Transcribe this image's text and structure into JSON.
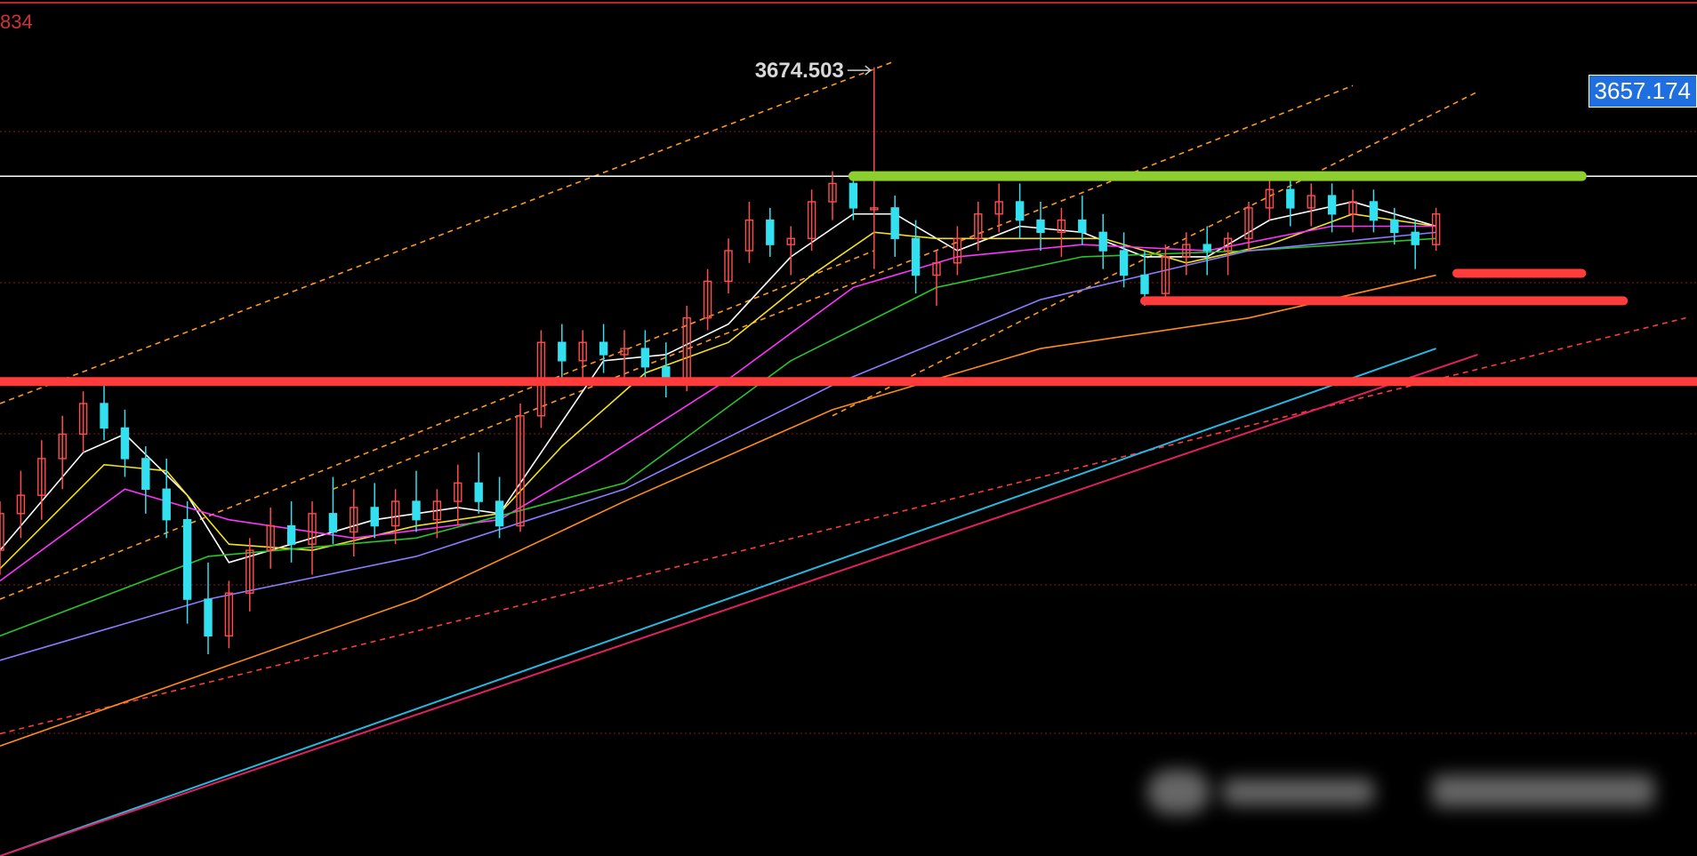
{
  "chart_data": {
    "type": "candlestick",
    "title": "",
    "xlabel": "",
    "ylabel": "",
    "ylim": [
      3546.0,
      3686.0
    ],
    "top_left_label": "834",
    "current_price": "3657.174",
    "high_annotation": "3674.503",
    "grid": "dotted red horizontal lines",
    "colors": {
      "background": "#000000",
      "bull_candle": "#ff4d4d",
      "bear_candle": "#33e0f0",
      "resistance": "#8ccf2e",
      "support": "#ff3b3b",
      "channel": "#ff9a1a",
      "ma5": "#ffffff",
      "ma10": "#f2e020",
      "ma20": "#ff33ff",
      "ma30": "#29c429",
      "ma60": "#8a7cff",
      "ma120": "#ff8c1a",
      "long_trend_1": "#29b7e0",
      "long_trend_2": "#e02060"
    },
    "horizontal_levels": [
      {
        "name": "resistance",
        "value": 3657.2
      },
      {
        "name": "support-minor",
        "value": 3641.3
      },
      {
        "name": "support-mid",
        "value": 3636.8
      },
      {
        "name": "support-major",
        "value": 3623.6
      }
    ],
    "candles": [
      [
        0,
        3596,
        3604,
        3592,
        3602
      ],
      [
        1,
        3602,
        3609,
        3598,
        3605
      ],
      [
        2,
        3605,
        3614,
        3601,
        3611
      ],
      [
        3,
        3611,
        3618,
        3606,
        3615
      ],
      [
        4,
        3615,
        3622,
        3612,
        3620
      ],
      [
        5,
        3620,
        3624,
        3614,
        3616
      ],
      [
        6,
        3616,
        3619,
        3608,
        3611
      ],
      [
        7,
        3611,
        3613,
        3602,
        3606
      ],
      [
        8,
        3606,
        3611,
        3598,
        3601
      ],
      [
        9,
        3601,
        3604,
        3584,
        3588
      ],
      [
        10,
        3588,
        3594,
        3579,
        3582
      ],
      [
        11,
        3582,
        3591,
        3580,
        3589
      ],
      [
        12,
        3589,
        3598,
        3586,
        3596
      ],
      [
        13,
        3596,
        3603,
        3593,
        3600
      ],
      [
        14,
        3600,
        3604,
        3594,
        3597
      ],
      [
        15,
        3597,
        3604,
        3592,
        3602
      ],
      [
        16,
        3602,
        3608,
        3597,
        3599
      ],
      [
        17,
        3599,
        3606,
        3595,
        3603
      ],
      [
        18,
        3603,
        3607,
        3598,
        3600
      ],
      [
        19,
        3600,
        3606,
        3597,
        3604
      ],
      [
        20,
        3604,
        3609,
        3599,
        3601
      ],
      [
        21,
        3601,
        3606,
        3598,
        3604
      ],
      [
        22,
        3604,
        3610,
        3600,
        3607
      ],
      [
        23,
        3607,
        3612,
        3602,
        3604
      ],
      [
        24,
        3604,
        3608,
        3598,
        3600
      ],
      [
        25,
        3600,
        3620,
        3599,
        3618
      ],
      [
        26,
        3618,
        3632,
        3616,
        3630
      ],
      [
        27,
        3630,
        3633,
        3624,
        3627
      ],
      [
        28,
        3627,
        3632,
        3623,
        3630
      ],
      [
        29,
        3630,
        3633,
        3625,
        3628
      ],
      [
        30,
        3628,
        3632,
        3624,
        3629
      ],
      [
        31,
        3629,
        3632,
        3624,
        3626
      ],
      [
        32,
        3626,
        3630,
        3621,
        3624
      ],
      [
        33,
        3624,
        3636,
        3622,
        3634
      ],
      [
        34,
        3634,
        3642,
        3632,
        3640
      ],
      [
        35,
        3640,
        3647,
        3638,
        3645
      ],
      [
        36,
        3645,
        3653,
        3643,
        3650
      ],
      [
        37,
        3650,
        3652,
        3644,
        3646
      ],
      [
        38,
        3646,
        3649,
        3641,
        3647
      ],
      [
        39,
        3647,
        3655,
        3645,
        3653
      ],
      [
        40,
        3653,
        3658,
        3650,
        3656
      ],
      [
        41,
        3656,
        3657,
        3650,
        3652
      ],
      [
        42,
        3652,
        3675,
        3642,
        3652
      ],
      [
        43,
        3652,
        3654,
        3644,
        3647
      ],
      [
        44,
        3647,
        3650,
        3638,
        3641
      ],
      [
        45,
        3641,
        3645,
        3636,
        3643
      ],
      [
        46,
        3643,
        3649,
        3641,
        3647
      ],
      [
        47,
        3647,
        3653,
        3645,
        3651
      ],
      [
        48,
        3651,
        3656,
        3648,
        3653
      ],
      [
        49,
        3653,
        3656,
        3647,
        3650
      ],
      [
        50,
        3650,
        3653,
        3645,
        3648
      ],
      [
        51,
        3648,
        3652,
        3644,
        3650
      ],
      [
        52,
        3650,
        3654,
        3646,
        3648
      ],
      [
        53,
        3648,
        3651,
        3642,
        3645
      ],
      [
        54,
        3645,
        3648,
        3639,
        3641
      ],
      [
        55,
        3641,
        3645,
        3636,
        3638
      ],
      [
        56,
        3638,
        3646,
        3637,
        3644
      ],
      [
        57,
        3644,
        3648,
        3641,
        3646
      ],
      [
        58,
        3646,
        3649,
        3641,
        3645
      ],
      [
        59,
        3645,
        3648,
        3641,
        3647
      ],
      [
        60,
        3647,
        3653,
        3645,
        3652
      ],
      [
        61,
        3652,
        3657,
        3650,
        3655
      ],
      [
        62,
        3655,
        3657,
        3649,
        3652
      ],
      [
        63,
        3652,
        3656,
        3649,
        3654
      ],
      [
        64,
        3654,
        3656,
        3648,
        3651
      ],
      [
        65,
        3651,
        3655,
        3648,
        3653
      ],
      [
        66,
        3653,
        3655,
        3648,
        3650
      ],
      [
        67,
        3650,
        3652,
        3646,
        3648
      ],
      [
        68,
        3648,
        3650,
        3642,
        3646
      ],
      [
        69,
        3646,
        3652,
        3645,
        3651
      ]
    ],
    "moving_averages": [
      {
        "name": "MA5",
        "color_key": "ma5",
        "values": [
          [
            0,
            3596
          ],
          [
            4,
            3612
          ],
          [
            6,
            3615
          ],
          [
            9,
            3605
          ],
          [
            11,
            3594
          ],
          [
            14,
            3597
          ],
          [
            18,
            3601
          ],
          [
            22,
            3603
          ],
          [
            24,
            3602
          ],
          [
            26,
            3612
          ],
          [
            29,
            3627
          ],
          [
            32,
            3628
          ],
          [
            35,
            3633
          ],
          [
            38,
            3644
          ],
          [
            41,
            3651
          ],
          [
            43,
            3651
          ],
          [
            46,
            3645
          ],
          [
            49,
            3649
          ],
          [
            52,
            3648
          ],
          [
            55,
            3644
          ],
          [
            58,
            3644
          ],
          [
            61,
            3650
          ],
          [
            65,
            3653
          ],
          [
            69,
            3649
          ]
        ]
      },
      {
        "name": "MA10",
        "color_key": "ma10",
        "values": [
          [
            0,
            3593
          ],
          [
            5,
            3610
          ],
          [
            8,
            3609
          ],
          [
            11,
            3597
          ],
          [
            15,
            3596
          ],
          [
            20,
            3600
          ],
          [
            24,
            3602
          ],
          [
            27,
            3613
          ],
          [
            31,
            3625
          ],
          [
            35,
            3630
          ],
          [
            39,
            3641
          ],
          [
            42,
            3648
          ],
          [
            45,
            3647
          ],
          [
            49,
            3647
          ],
          [
            53,
            3647
          ],
          [
            57,
            3643
          ],
          [
            61,
            3646
          ],
          [
            65,
            3651
          ],
          [
            69,
            3649
          ]
        ]
      },
      {
        "name": "MA20",
        "color_key": "ma20",
        "values": [
          [
            0,
            3591
          ],
          [
            6,
            3606
          ],
          [
            11,
            3601
          ],
          [
            17,
            3598
          ],
          [
            24,
            3601
          ],
          [
            29,
            3611
          ],
          [
            35,
            3624
          ],
          [
            41,
            3639
          ],
          [
            46,
            3644
          ],
          [
            52,
            3646
          ],
          [
            58,
            3645
          ],
          [
            64,
            3649
          ],
          [
            69,
            3649
          ]
        ]
      },
      {
        "name": "MA30",
        "color_key": "ma30",
        "values": [
          [
            0,
            3582
          ],
          [
            10,
            3595
          ],
          [
            20,
            3598
          ],
          [
            30,
            3607
          ],
          [
            38,
            3627
          ],
          [
            45,
            3639
          ],
          [
            52,
            3644
          ],
          [
            60,
            3645
          ],
          [
            69,
            3647
          ]
        ]
      },
      {
        "name": "MA60",
        "color_key": "ma60",
        "values": [
          [
            0,
            3578
          ],
          [
            10,
            3588
          ],
          [
            20,
            3595
          ],
          [
            30,
            3606
          ],
          [
            40,
            3623
          ],
          [
            50,
            3637
          ],
          [
            60,
            3645
          ],
          [
            69,
            3648
          ]
        ]
      },
      {
        "name": "MA120",
        "color_key": "ma120",
        "values": [
          [
            0,
            3564
          ],
          [
            10,
            3576
          ],
          [
            20,
            3588
          ],
          [
            30,
            3604
          ],
          [
            40,
            3619
          ],
          [
            50,
            3629
          ],
          [
            60,
            3634
          ],
          [
            69,
            3641
          ]
        ]
      }
    ],
    "trend_lines": [
      {
        "name": "channel-upper",
        "color_key": "channel",
        "style": "dashed",
        "points": [
          [
            0,
            3620
          ],
          [
            43,
            3676
          ]
        ]
      },
      {
        "name": "channel-lower",
        "color_key": "channel",
        "style": "dashed",
        "points": [
          [
            0,
            3588
          ],
          [
            42,
            3645
          ]
        ]
      },
      {
        "name": "channel-upper-2",
        "color_key": "channel",
        "style": "dashed",
        "points": [
          [
            16,
            3606
          ],
          [
            65,
            3672
          ]
        ]
      },
      {
        "name": "channel-upper-3",
        "color_key": "channel",
        "style": "dashed",
        "points": [
          [
            40,
            3618
          ],
          [
            71,
            3671
          ]
        ]
      },
      {
        "name": "red-dashed-trend",
        "color_key": "support",
        "style": "dashed",
        "points": [
          [
            0,
            3566
          ],
          [
            81,
            3634
          ]
        ]
      },
      {
        "name": "long-trend-blue",
        "color_key": "long_trend_1",
        "style": "solid",
        "points": [
          [
            0,
            3546
          ],
          [
            69,
            3629
          ]
        ]
      },
      {
        "name": "long-trend-red",
        "color_key": "long_trend_2",
        "style": "solid",
        "points": [
          [
            0,
            3546
          ],
          [
            71,
            3628
          ]
        ]
      }
    ],
    "segments": [
      {
        "name": "resistance-line",
        "color_key": "resistance",
        "from": 41,
        "to": 76,
        "value": 3657.2
      },
      {
        "name": "support-line-minor",
        "color_key": "support",
        "from": 70,
        "to": 76,
        "value": 3641.3
      },
      {
        "name": "support-line-mid",
        "color_key": "support",
        "from": 55,
        "to": 78,
        "value": 3636.8
      },
      {
        "name": "support-line-major",
        "color_key": "support",
        "from": 0,
        "to": 82,
        "value": 3623.6
      }
    ]
  }
}
